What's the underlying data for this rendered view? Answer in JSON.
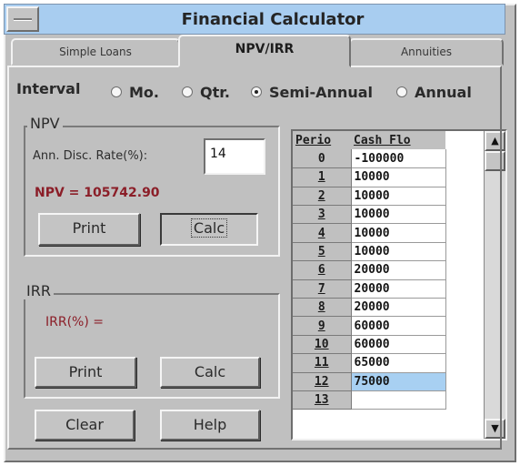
{
  "window": {
    "title": "Financial Calculator"
  },
  "tabs": [
    {
      "label": "Simple Loans",
      "active": false
    },
    {
      "label": "NPV/IRR",
      "active": true
    },
    {
      "label": "Annuities",
      "active": false
    }
  ],
  "interval": {
    "label": "Interval",
    "options": [
      {
        "label": "Mo.",
        "selected": false
      },
      {
        "label": "Qtr.",
        "selected": false
      },
      {
        "label": "Semi-Annual",
        "selected": true
      },
      {
        "label": "Annual",
        "selected": false
      }
    ]
  },
  "npv": {
    "group_label": "NPV",
    "rate_label": "Ann. Disc. Rate(%):",
    "rate_value": "14",
    "result_label": "NPV =",
    "result_value": "105742.90",
    "print_label": "Print",
    "calc_label": "Calc"
  },
  "irr": {
    "group_label": "IRR",
    "result_label": "IRR(%) =",
    "print_label": "Print",
    "calc_label": "Calc"
  },
  "footer": {
    "clear_label": "Clear",
    "help_label": "Help"
  },
  "grid": {
    "columns": [
      "Perio",
      "Cash Flo"
    ],
    "rows": [
      {
        "period": "0",
        "cash": "-100000"
      },
      {
        "period": "1",
        "cash": "10000"
      },
      {
        "period": "2",
        "cash": "10000"
      },
      {
        "period": "3",
        "cash": "10000"
      },
      {
        "period": "4",
        "cash": "10000"
      },
      {
        "period": "5",
        "cash": "10000"
      },
      {
        "period": "6",
        "cash": "20000"
      },
      {
        "period": "7",
        "cash": "20000"
      },
      {
        "period": "8",
        "cash": "20000"
      },
      {
        "period": "9",
        "cash": "60000"
      },
      {
        "period": "10",
        "cash": "60000"
      },
      {
        "period": "11",
        "cash": "65000"
      },
      {
        "period": "12",
        "cash": "75000"
      },
      {
        "period": "13",
        "cash": ""
      }
    ],
    "selected_row": 12,
    "scroll_up_icon": "arrow-up-icon",
    "scroll_down_icon": "arrow-down-icon"
  },
  "colors": {
    "title_bar": "#a8cdf0",
    "result_text": "#8b1e28",
    "selection": "#a8d0f2"
  }
}
